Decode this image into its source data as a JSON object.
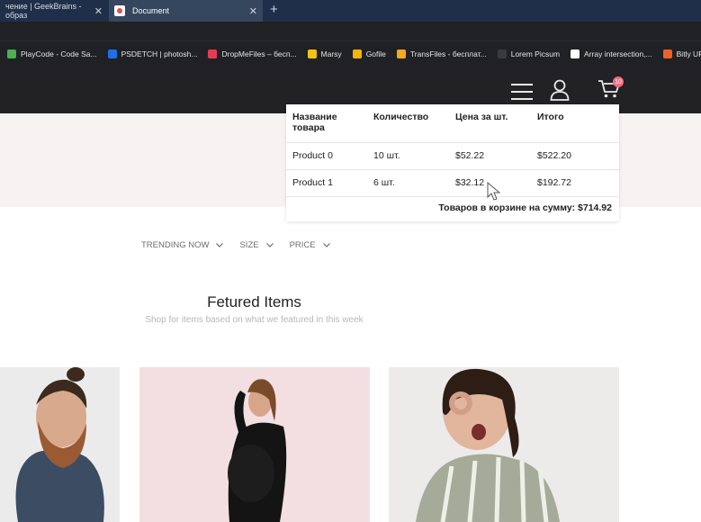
{
  "browser": {
    "tabs": [
      {
        "label": "чение | GeekBrains - образ"
      },
      {
        "label": "Document"
      }
    ],
    "new_tab_symbol": "+",
    "close_symbol": "✕",
    "bookmarks": [
      {
        "label": "PlayCode - Code Sa...",
        "icon_color": "#4caf50"
      },
      {
        "label": "PSDETCH | photosh...",
        "icon_color": "#1f6feb"
      },
      {
        "label": "DropMeFiles – бесп...",
        "icon_color": "#e63b55"
      },
      {
        "label": "Marsy",
        "icon_color": "#f0c419"
      },
      {
        "label": "Gofile",
        "icon_color": "#f2b705"
      },
      {
        "label": "TransFiles - бесплат...",
        "icon_color": "#f5a623"
      },
      {
        "label": "Lorem Picsum",
        "icon_color": "#3a3a3a"
      },
      {
        "label": "Array intersection,...",
        "icon_color": "#ffffff"
      },
      {
        "label": "Bitly URL Sh",
        "icon_color": "#ee6123"
      }
    ]
  },
  "header": {
    "cart_count": "10"
  },
  "cart": {
    "columns": [
      "Название товара",
      "Количество",
      "Цена за шт.",
      "Итого"
    ],
    "rows": [
      [
        "Product 0",
        "10 шт.",
        "$52.22",
        "$522.20"
      ],
      [
        "Product 1",
        "6 шт.",
        "$32.12",
        "$192.72"
      ]
    ],
    "total_label": "Товаров в корзине на сумму: $714.92"
  },
  "filters": [
    {
      "label": "TRENDING NOW"
    },
    {
      "label": "SIZE"
    },
    {
      "label": "PRICE"
    }
  ],
  "featured": {
    "title": "Fetured Items",
    "subtitle": "Shop for items based on what we featured in this week"
  },
  "colors": {
    "header_bg": "#222224",
    "hero_bg": "#f8f3f3",
    "badge": "#f16d7f"
  }
}
